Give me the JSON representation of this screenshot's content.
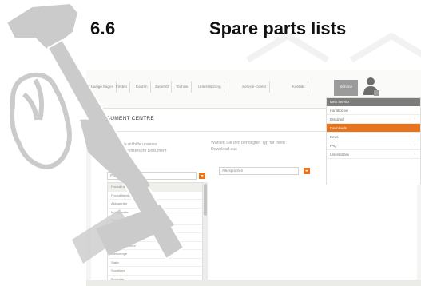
{
  "heading": {
    "number": "6.6",
    "title": "Spare parts lists"
  },
  "nav": {
    "items": [
      "Häufige fragen",
      "Finden",
      "Kaufen",
      "Zubehör",
      "Technik",
      "Unterstützung",
      "Service-Center",
      "Kontakt"
    ],
    "active": "Service"
  },
  "dropdown": {
    "header": "Mein Service",
    "items": [
      {
        "label": "Handbücher",
        "arrow": false,
        "active": false
      },
      {
        "label": "Ersatzteil",
        "arrow": true,
        "active": false
      },
      {
        "label": "Downloads",
        "arrow": false,
        "active": true
      },
      {
        "label": "News",
        "arrow": false,
        "active": false
      },
      {
        "label": "FAQ",
        "arrow": true,
        "active": false
      },
      {
        "label": "Unterstützen",
        "arrow": true,
        "active": false
      }
    ]
  },
  "document_centre": {
    "title": "DOCUMENT CENTRE",
    "instruction_left": "Finden Sie mithilfe unseres Dokumentenfilters Ihr Dokument",
    "instruction_right": "Wählen Sie den benötigten Typ für Ihren Download aus",
    "select_left": "Produkt auswählen",
    "select_right": "Alle Sprachen",
    "list": [
      "Produkt auswählen",
      "Produktfamilie",
      "Akkugeräte",
      "Motorgeräte",
      "Elektrogeräte",
      "Schutzausrüstung",
      "Zubehör",
      "Ersatzteilzubehör",
      "Werkzeuge",
      "Stativ",
      "Sonstiges",
      "Produkte"
    ]
  },
  "colors": {
    "accent": "#e8731c",
    "hammer": "#c8c8c8"
  }
}
